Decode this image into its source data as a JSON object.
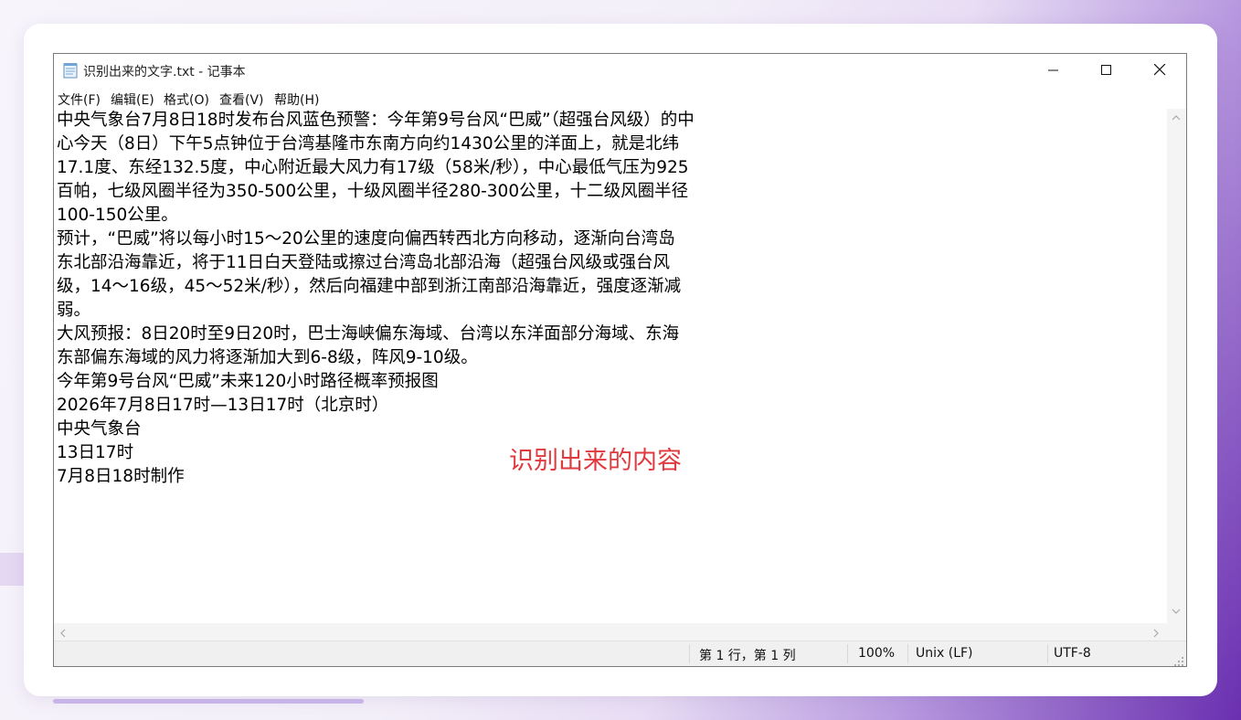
{
  "window": {
    "title": "识别出来的文字.txt - 记事本",
    "icon": "notepad-icon"
  },
  "menu": [
    {
      "label": "文件(F)"
    },
    {
      "label": "编辑(E)"
    },
    {
      "label": "格式(O)"
    },
    {
      "label": "查看(V)"
    },
    {
      "label": "帮助(H)"
    }
  ],
  "document": {
    "lines": [
      "中央气象台7月8日18时发布台风蓝色预警：今年第9号台风“巴威”（超强台风级）的中",
      "心今天（8日）下午5点钟位于台湾基隆市东南方向约1430公里的洋面上，就是北纬",
      "17.1度、东经132.5度，中心附近最大风力有17级（58米/秒），中心最低气压为925",
      "百帕，七级风圈半径为350-500公里，十级风圈半径280-300公里，十二级风圈半径",
      "100-150公里。",
      "预计，“巴威”将以每小时15～20公里的速度向偏西转西北方向移动，逐渐向台湾岛",
      "东北部沿海靠近，将于11日白天登陆或擦过台湾岛北部沿海（超强台风级或强台风",
      "级，14～16级，45～52米/秒），然后向福建中部到浙江南部沿海靠近，强度逐渐减",
      "弱。",
      "大风预报：8日20时至9日20时，巴士海峡偏东海域、台湾以东洋面部分海域、东海",
      "东部偏东海域的风力将逐渐加大到6-8级，阵风9-10级。",
      "今年第9号台风“巴威”未来120小时路径概率预报图",
      "2026年7月8日17时—13日17时（北京时）",
      "中央气象台",
      "13日17时",
      "7月8日18时制作"
    ]
  },
  "status": {
    "position": "第 1 行，第 1 列",
    "zoom": "100%",
    "line_ending": "Unix (LF)",
    "encoding": "UTF-8"
  },
  "annotation": {
    "label": "识别出来的内容",
    "color": "#e0393e"
  }
}
